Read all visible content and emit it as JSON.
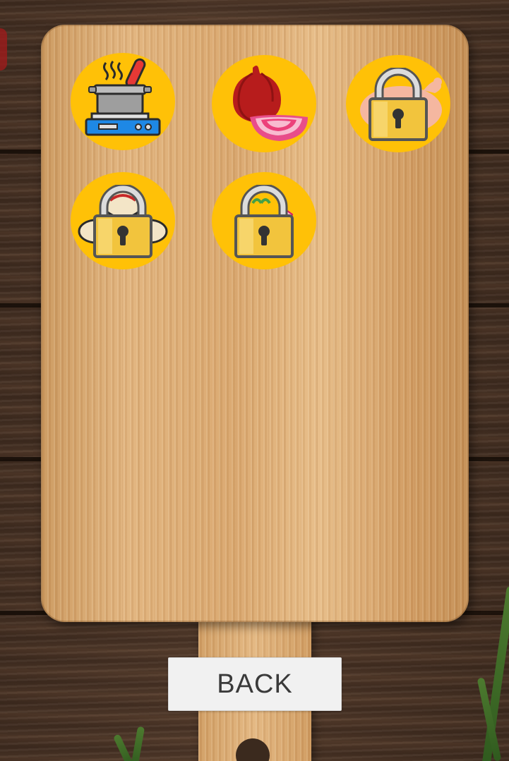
{
  "screen": "level-select",
  "colors": {
    "tile": "#ffc107",
    "lock_body": "#f2c43d",
    "lock_shackle": "#d9d9d9",
    "button_bg": "#f1f1f1",
    "button_text": "#3a3a3a"
  },
  "levels": [
    {
      "icon": "cooking-pot-on-stove-icon",
      "locked": false
    },
    {
      "icon": "red-onion-icon",
      "locked": false
    },
    {
      "icon": "raw-chicken-icon",
      "locked": true
    },
    {
      "icon": "dumplings-icon",
      "locked": true
    },
    {
      "icon": "vegetables-icon",
      "locked": true
    }
  ],
  "footer": {
    "back_label": "BACK"
  }
}
